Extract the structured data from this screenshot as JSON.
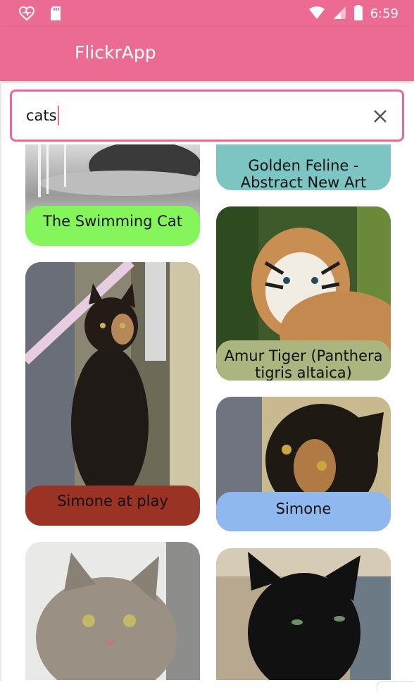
{
  "status_bar": {
    "time": "6:59",
    "icons": [
      "heart-monitor-icon",
      "sd-card-icon",
      "wifi-icon",
      "signal-icon",
      "battery-icon"
    ]
  },
  "app_bar": {
    "title": "FlickrApp",
    "color": "#ec6b93"
  },
  "search": {
    "value": "cats",
    "clear_icon": "close-icon"
  },
  "photos": [
    {
      "caption": "The Swimming Cat",
      "color": "#85f55c"
    },
    {
      "caption": "Golden Feline - Abstract New Art",
      "color": "#7cc5c2"
    },
    {
      "caption": "Amur Tiger (Panthera tigris altaica)",
      "color": "#aab57f"
    },
    {
      "caption": "Simone at play",
      "color": "#9a3324"
    },
    {
      "caption": "Simone",
      "color": "#8fb8ee"
    },
    {
      "caption": "",
      "color": "#000000"
    },
    {
      "caption": "",
      "color": "#000000"
    }
  ]
}
